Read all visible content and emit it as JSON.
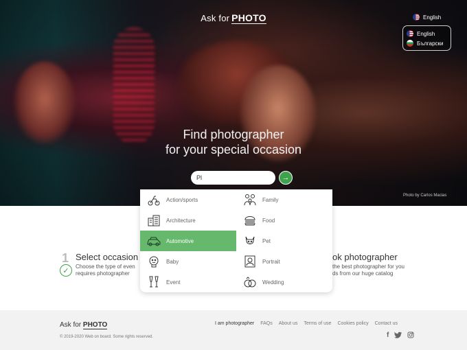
{
  "logo": {
    "part1": "Ask for",
    "part2": "PHOTO"
  },
  "language": {
    "current": "English",
    "options": [
      "English",
      "Български"
    ]
  },
  "hero": {
    "headline_line1": "Find photographer",
    "headline_line2": "for your special occasion",
    "photo_credit": "Photo by Carlos Macias"
  },
  "search": {
    "value": "Pl",
    "button_icon": "arrow-right-icon"
  },
  "categories": [
    {
      "label": "Action/sports",
      "icon": "action-sports-icon",
      "selected": false
    },
    {
      "label": "Family",
      "icon": "family-icon",
      "selected": false
    },
    {
      "label": "Architecture",
      "icon": "architecture-icon",
      "selected": false
    },
    {
      "label": "Food",
      "icon": "food-icon",
      "selected": false
    },
    {
      "label": "Automotive",
      "icon": "car-icon",
      "selected": true
    },
    {
      "label": "Pet",
      "icon": "pet-icon",
      "selected": false
    },
    {
      "label": "Baby",
      "icon": "baby-icon",
      "selected": false
    },
    {
      "label": "Portrait",
      "icon": "portrait-icon",
      "selected": false
    },
    {
      "label": "Event",
      "icon": "event-icon",
      "selected": false
    },
    {
      "label": "Wedding",
      "icon": "wedding-rings-icon",
      "selected": false
    }
  ],
  "steps": {
    "step1_number": "1",
    "step1_title": "Select occasion",
    "step1_line1": "Choose the type of even",
    "step1_line2": "requires photographer",
    "step3_title": "ok photographer",
    "step3_line1": "the best photographer for you",
    "step3_line2": "ds from our huge catalog"
  },
  "footer": {
    "logo_part1": "Ask for",
    "logo_part2": "PHOTO",
    "copyright": "© 2019-2020 Web on board. Some rights reserved.",
    "links": [
      "I am photographer",
      "FAQs",
      "About us",
      "Terms of use",
      "Cookies policy",
      "Contact us"
    ],
    "social": [
      "facebook-icon",
      "twitter-icon",
      "instagram-icon"
    ]
  },
  "colors": {
    "accent": "#3fa34d",
    "selected_item": "#66b86c",
    "footer_bg": "#f2f2f2"
  }
}
